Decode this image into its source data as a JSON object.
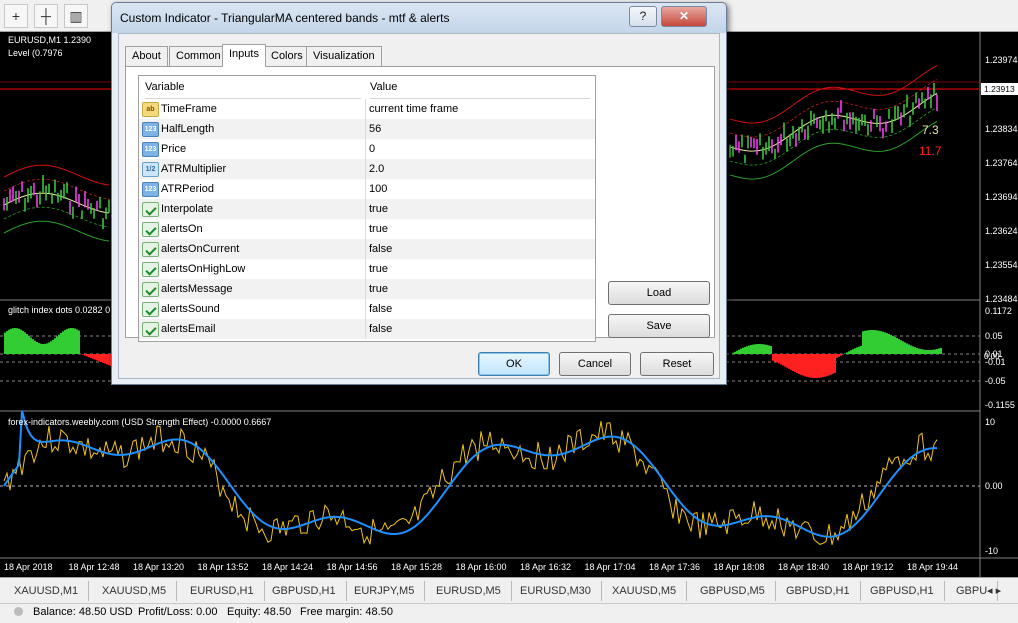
{
  "toolbar": {
    "btn_plus": "+",
    "btn_crosshair": "┼"
  },
  "chart": {
    "symbol_label": "EURUSD,M1  1.2390",
    "level_label": "Level (0.7976",
    "price_labels": [
      "1.23974",
      "1.23913",
      "1.23834",
      "1.23764",
      "1.23694",
      "1.23624",
      "1.23554",
      "1.23484"
    ],
    "current_price": "1.23913",
    "value_label_1": "7.3",
    "value_label_2": "11.7",
    "glitch_label": "glitch index dots 0.0282 0",
    "glitch_axis": [
      "0.1172",
      "0.05",
      "0.01",
      "-0.01",
      "-0.05",
      "-0.1155"
    ],
    "glitch_axis_extra": "0.00",
    "usd_label": "forex-indicators.weebly.com (USD Strength Effect) -0.0000 0.6667",
    "usd_axis": [
      "10",
      "0.00",
      "-10"
    ],
    "time_labels": [
      "18 Apr 2018",
      "18 Apr 12:48",
      "18 Apr 13:20",
      "18 Apr 13:52",
      "18 Apr 14:24",
      "18 Apr 14:56",
      "18 Apr 15:28",
      "18 Apr 16:00",
      "18 Apr 16:32",
      "18 Apr 17:04",
      "18 Apr 17:36",
      "18 Apr 18:08",
      "18 Apr 18:40",
      "18 Apr 19:12",
      "18 Apr 19:44"
    ]
  },
  "dialog": {
    "title": "Custom Indicator - TriangularMA centered bands - mtf & alerts",
    "caption_help": "?",
    "caption_close": "✕",
    "tabs": [
      "About",
      "Common",
      "Inputs",
      "Colors",
      "Visualization"
    ],
    "active_tab": "Inputs",
    "col_variable": "Variable",
    "col_value": "Value",
    "rows": [
      {
        "icon": "ab",
        "name": "TimeFrame",
        "value": "current time frame"
      },
      {
        "icon": "123",
        "name": "HalfLength",
        "value": "56"
      },
      {
        "icon": "123",
        "name": "Price",
        "value": "0"
      },
      {
        "icon": "dbl",
        "name": "ATRMultiplier",
        "value": "2.0"
      },
      {
        "icon": "123",
        "name": "ATRPeriod",
        "value": "100"
      },
      {
        "icon": "bool",
        "name": "Interpolate",
        "value": "true"
      },
      {
        "icon": "bool",
        "name": "alertsOn",
        "value": "true"
      },
      {
        "icon": "bool",
        "name": "alertsOnCurrent",
        "value": "false"
      },
      {
        "icon": "bool",
        "name": "alertsOnHighLow",
        "value": "true"
      },
      {
        "icon": "bool",
        "name": "alertsMessage",
        "value": "true"
      },
      {
        "icon": "bool",
        "name": "alertsSound",
        "value": "false"
      },
      {
        "icon": "bool",
        "name": "alertsEmail",
        "value": "false"
      }
    ],
    "icon_text": {
      "ab": "ab",
      "123": "123",
      "dbl": "1/2",
      "bool": ""
    },
    "load_label": "Load",
    "save_label": "Save",
    "ok_label": "OK",
    "cancel_label": "Cancel",
    "reset_label": "Reset"
  },
  "symbol_tabs": [
    "XAUUSD,M1",
    "XAUUSD,M5",
    "EURUSD,H1",
    "GBPUSD,H1",
    "EURJPY,M5",
    "EURUSD,M5",
    "EURUSD,M30",
    "XAUUSD,M5",
    "GBPUSD,M5",
    "GBPUSD,H1",
    "GBPUSD,H1",
    "GBPU"
  ],
  "status": {
    "balance": "Balance: 48.50 USD",
    "profit": "Profit/Loss: 0.00",
    "equity": "Equity: 48.50",
    "free_margin": "Free margin: 48.50"
  },
  "colors": {
    "price_line": "#ff0000",
    "usd_main": "#f0c419",
    "usd_signal": "#1e90ff",
    "glitch_up": "#32cd32",
    "glitch_down": "#ff2020"
  }
}
